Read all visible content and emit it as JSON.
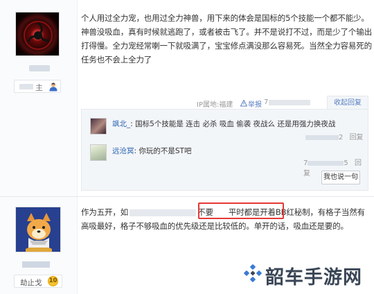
{
  "post1": {
    "content": "个人用过全力宠，也用过全力神兽，用下来的体会是国标的5个技能一个都不能少。神兽没吸血，真有时候就逃跑了，或者被击飞了。并不是说打不过，而是少了个输出打得慢。全力宠经常喇一下就吸满了，宝宝修点满没那么容易死。当然全力容易死的任务也不会上全力了",
    "badge_text": "主",
    "ip_label": "IP属地:福建",
    "report_label": "举报",
    "date_prefix": "7",
    "collapse_label": "收起回复",
    "replies": [
      {
        "name": "飒北_",
        "sep": ": ",
        "text": "国标5个技能是 连击 必杀 吸血 偷袭 夜战么 还是用强力换夜战",
        "time_suffix": "2",
        "action": "回复"
      },
      {
        "name": "远沧冥",
        "sep": ": ",
        "text": "你玩的不是ST吧",
        "time_prefix": "7",
        "time_suffix": "5",
        "action": "回复"
      }
    ],
    "say_button": "我也说一句"
  },
  "post2": {
    "content_a": "作为五开，如",
    "content_b": "不要",
    "content_highlight": "平时都是开着BB红秘制",
    "content_c": "，有格子当然有高吸最好，格子不够吸血的优先级还是比较低的。单开的话，吸血还是要的。",
    "badge_text": "劫止戈",
    "level": "10"
  },
  "watermark": {
    "text": "韶车手游网"
  },
  "colors": {
    "link": "#2d64b3",
    "highlight_border": "#e53935",
    "badge_gold": "#f6c22e"
  }
}
